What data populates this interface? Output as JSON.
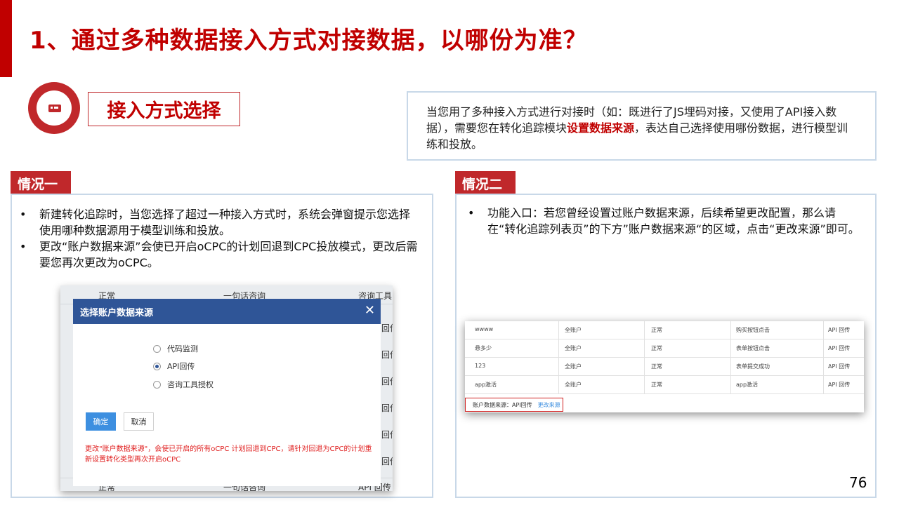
{
  "title": "1、通过多种数据接入方式对接数据，以哪份为准？",
  "method_label": "接入方式选择",
  "info": {
    "part1": "当您用了多种接入方式进行对接时（如：既进行了JS埋码对接，又使用了API接入数据），需要您在转化追踪模块",
    "highlight": "设置数据来源",
    "part2": "，表达自己选择使用哪份数据，进行模型训练和投放。"
  },
  "case1": {
    "label": "情况一",
    "bullets": [
      "新建转化追踪时，当您选择了超过一种接入方式时，系统会弹窗提示您选择使用哪种数据源用于模型训练和投放。",
      "更改“账户数据来源”会使已开启oCPC的计划回退到CPC投放模式，更改后需要您再次更改为oCPC。"
    ]
  },
  "case2": {
    "label": "情况二",
    "bullets": [
      "功能入口：若您曾经设置过账户数据来源，后续希望更改配置，那么请在“转化追踪列表页”的下方”账户数据来源“的区域，点击“更改来源”即可。"
    ]
  },
  "shot1": {
    "bg_header": [
      "正常",
      "一句话咨询",
      "咨询工具"
    ],
    "bg_right_fragments": [
      "回传",
      "回传",
      "回传",
      "回传",
      "回传",
      "回传",
      "回传",
      "回传"
    ],
    "bg_bottom": [
      "正常",
      "一句话咨询",
      "API 回传"
    ],
    "dialog": {
      "title": "选择账户数据来源",
      "close": "✕",
      "options": [
        {
          "label": "代码监测",
          "selected": false
        },
        {
          "label": "API回传",
          "selected": true
        },
        {
          "label": "咨询工具授权",
          "selected": false
        }
      ],
      "confirm": "确定",
      "cancel": "取消",
      "warning": "更改\"账户数据来源\"，会使已开启的所有oCPC 计划回退到CPC，请针对回退为CPC的计划重新设置转化类型再次开启oCPC"
    }
  },
  "shot2": {
    "rows": [
      [
        "wwww",
        "全账户",
        "正常",
        "购买按钮点击",
        "API 回传"
      ],
      [
        "悬多少",
        "全账户",
        "正常",
        "表单按钮点击",
        "API 回传"
      ],
      [
        "123",
        "全账户",
        "正常",
        "表单提交成功",
        "API 回传"
      ],
      [
        "app激活",
        "全账户",
        "正常",
        "app激活",
        "API 回传"
      ]
    ],
    "source_label": "账户数据来源：API回传",
    "source_link": "更改来源"
  },
  "page_number": "76",
  "colors": {
    "accent": "#c00000",
    "panel_border": "#c8d8e8",
    "dialog_header": "#2f5597"
  }
}
